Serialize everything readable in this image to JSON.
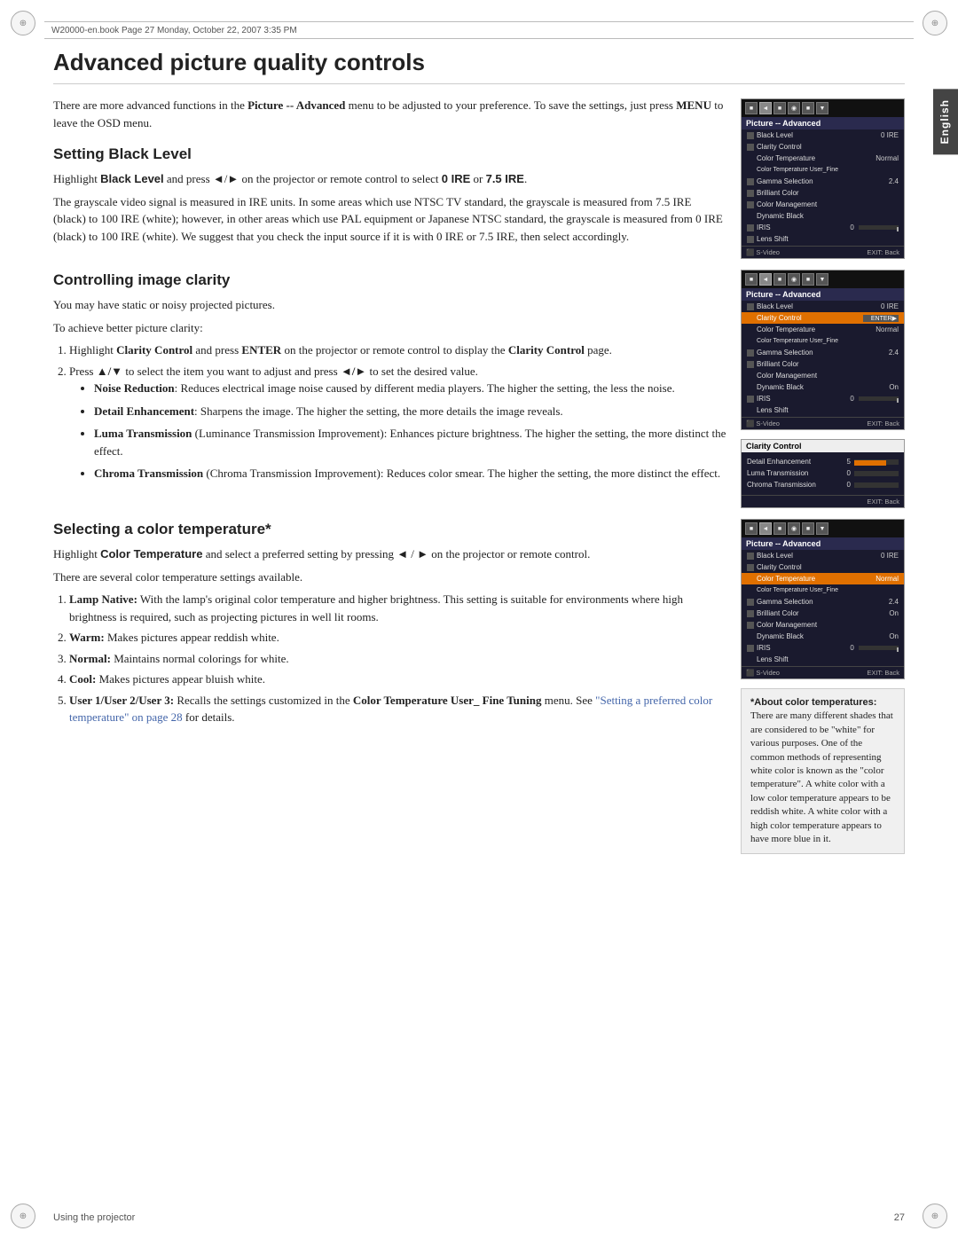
{
  "header": {
    "bar_text": "W20000-en.book  Page 27  Monday, October 22, 2007  3:35 PM"
  },
  "english_tab": "English",
  "page_title": "Advanced picture quality controls",
  "intro": "There are more advanced functions in the Picture -- Advanced menu to be adjusted to your preference. To save the settings, just press MENU to leave the OSD menu.",
  "sections": {
    "black_level": {
      "title": "Setting Black Level",
      "para1": "Highlight Black Level and press ◄/► on the projector or remote control to select 0 IRE or 7.5 IRE.",
      "para2": "The grayscale video signal is measured in IRE units. In some areas which use NTSC TV standard, the grayscale is measured from 7.5 IRE (black) to 100 IRE (white); however, in other areas which use PAL equipment or Japanese NTSC standard, the grayscale is measured from 0 IRE (black) to 100 IRE (white). We suggest that you check the input source if it is with 0 IRE or 7.5 IRE, then select accordingly."
    },
    "image_clarity": {
      "title": "Controlling image clarity",
      "para1": "You may have static or noisy projected pictures.",
      "para2": "To achieve better picture clarity:",
      "step1_prefix": "1.",
      "step1": "Highlight Clarity Control and press ENTER on the projector or remote control to display the Clarity Control page.",
      "step2_prefix": "2.",
      "step2": "Press ▲/▼ to select the item you want to adjust and press ◄/► to set the desired value.",
      "bullets": [
        {
          "bold": "Noise Reduction",
          "text": ": Reduces electrical image noise caused by different media players. The higher the setting, the less the noise."
        },
        {
          "bold": "Detail Enhancement",
          "text": ": Sharpens the image. The higher the setting, the more details the image reveals."
        },
        {
          "bold": "Luma Transmission",
          "text": " (Luminance Transmission Improvement): Enhances picture brightness. The higher the setting, the more distinct the effect."
        },
        {
          "bold": "Chroma Transmission",
          "text": " (Chroma Transmission Improvement): Reduces color smear. The higher the setting, the more distinct the effect."
        }
      ]
    },
    "color_temp": {
      "title": "Selecting a color temperature*",
      "para1": "Highlight Color Temperature and select a preferred setting by pressing ◄ / ► on the projector or remote control.",
      "para2": "There are several color temperature settings available.",
      "items": [
        {
          "num": "1.",
          "bold": "Lamp Native:",
          "text": " With the lamp's original color temperature and higher brightness. This setting is suitable for environments where high brightness is required, such as projecting pictures in well lit rooms."
        },
        {
          "num": "2.",
          "bold": "Warm:",
          "text": " Makes pictures appear reddish white."
        },
        {
          "num": "3.",
          "bold": "Normal:",
          "text": " Maintains normal colorings for white."
        },
        {
          "num": "4.",
          "bold": "Cool:",
          "text": " Makes pictures appear bluish white."
        },
        {
          "num": "5.",
          "bold": "User 1/User 2/User 3:",
          "text": " Recalls the settings customized in the Color Temperature User_ Fine Tuning menu. See "
        },
        {
          "link": "\"Setting a preferred color temperature\" on page 28",
          "text2": " for details."
        }
      ],
      "footnote": "*About color temperatures:\nThere are many different shades that are considered to be \"white\" for various purposes. One of the common methods of representing white color is known as the \"color temperature\". A white color with a low color temperature appears to be reddish white. A white color with a high color temperature appears to have more blue in it."
    }
  },
  "osd": {
    "title": "Picture -- Advanced",
    "items_adv1": [
      {
        "label": "Black Level",
        "val": "0 IRE",
        "icon": true
      },
      {
        "label": "Clarity Control",
        "val": "",
        "icon": true
      },
      {
        "label": "Color Temperature",
        "val": "Normal",
        "icon": false
      },
      {
        "label": "Color Temperature User_Fine",
        "val": "",
        "icon": false
      },
      {
        "label": "Gamma Selection",
        "val": "2.4",
        "icon": true
      },
      {
        "label": "Brilliant Color",
        "val": "",
        "icon": true
      },
      {
        "label": "Color Management",
        "val": "",
        "icon": true
      },
      {
        "label": "Dynamic Black",
        "val": "",
        "icon": false
      },
      {
        "label": "IRIS",
        "val": "0",
        "icon": true
      },
      {
        "label": "Lens Shift",
        "val": "",
        "icon": true
      }
    ],
    "items_adv2": [
      {
        "label": "Black Level",
        "val": "0 IRE",
        "icon": true
      },
      {
        "label": "Clarity Control",
        "val": "ENTER",
        "icon": true,
        "highlighted": true
      },
      {
        "label": "Color Temperature",
        "val": "Normal",
        "icon": false
      },
      {
        "label": "Color Temperature User_Fine",
        "val": "",
        "icon": false
      },
      {
        "label": "Gamma Selection",
        "val": "2.4",
        "icon": true
      },
      {
        "label": "Brilliant Color",
        "val": "",
        "icon": true
      },
      {
        "label": "Color Management",
        "val": "",
        "icon": false
      },
      {
        "label": "Dynamic Black",
        "val": "On",
        "icon": false
      },
      {
        "label": "IRIS",
        "val": "0",
        "icon": true
      },
      {
        "label": "Lens Shift",
        "val": "",
        "icon": false
      }
    ],
    "items_adv3": [
      {
        "label": "Black Level",
        "val": "0 IRE",
        "icon": true
      },
      {
        "label": "Clarity Control",
        "val": "",
        "icon": true
      },
      {
        "label": "Color Temperature",
        "val": "Normal",
        "icon": false,
        "highlighted": true
      },
      {
        "label": "Color Temperature User_Fine",
        "val": "",
        "icon": false
      },
      {
        "label": "Gamma Selection",
        "val": "2.4",
        "icon": true
      },
      {
        "label": "Brilliant Color",
        "val": "On",
        "icon": true
      },
      {
        "label": "Color Management",
        "val": "",
        "icon": true
      },
      {
        "label": "Dynamic Black",
        "val": "On",
        "icon": false
      },
      {
        "label": "IRIS",
        "val": "0",
        "icon": true
      },
      {
        "label": "Lens Shift",
        "val": "",
        "icon": false
      }
    ],
    "clarity_items": [
      {
        "label": "Detail Enhancement",
        "val": 5,
        "max": 7
      },
      {
        "label": "Luma Transmission",
        "val": 0,
        "max": 7
      },
      {
        "label": "Chroma Transmission",
        "val": 0,
        "max": 7
      }
    ],
    "source": "S-Video",
    "exit": "EXIT: Back"
  },
  "footer": {
    "left": "Using the projector",
    "right": "27"
  }
}
